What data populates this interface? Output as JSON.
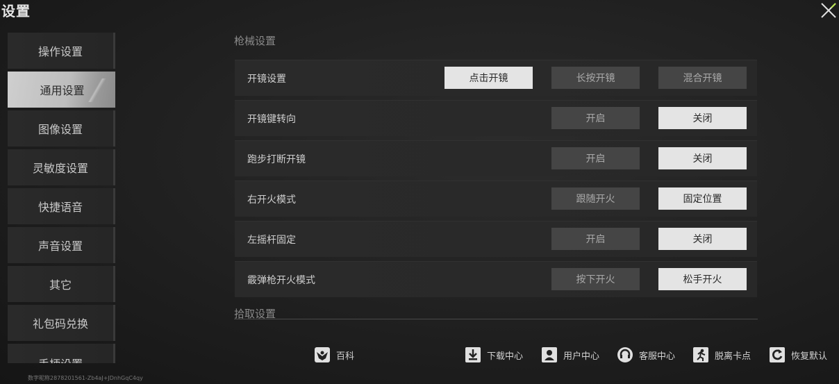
{
  "window": {
    "title": "设置"
  },
  "sidebar": {
    "items": [
      {
        "label": "操作设置"
      },
      {
        "label": "通用设置"
      },
      {
        "label": "图像设置"
      },
      {
        "label": "灵敏度设置"
      },
      {
        "label": "快捷语音"
      },
      {
        "label": "声音设置"
      },
      {
        "label": "其它"
      },
      {
        "label": "礼包码兑换"
      },
      {
        "label": "手柄设置"
      }
    ],
    "active_index": 1
  },
  "account_text": "数字昵称2878201561-Zb4aJ+JDnhGqC4qy",
  "gun_settings": {
    "title": "枪械设置",
    "rows": [
      {
        "label": "开镜设置",
        "options": [
          "点击开镜",
          "长按开镜",
          "混合开镜"
        ],
        "selected": "点击开镜"
      },
      {
        "label": "开镜键转向",
        "options": [
          "开启",
          "关闭"
        ],
        "selected": "关闭"
      },
      {
        "label": "跑步打断开镜",
        "options": [
          "开启",
          "关闭"
        ],
        "selected": "关闭"
      },
      {
        "label": "右开火模式",
        "options": [
          "跟随开火",
          "固定位置"
        ],
        "selected": "固定位置"
      },
      {
        "label": "左摇杆固定",
        "options": [
          "开启",
          "关闭"
        ],
        "selected": "关闭"
      },
      {
        "label": "霰弹枪开火模式",
        "options": [
          "按下开火",
          "松手开火"
        ],
        "selected": "松手开火"
      }
    ]
  },
  "pickup_settings": {
    "title": "拾取设置"
  },
  "bottom_bar": {
    "wiki": "百科",
    "download": "下载中心",
    "user": "用户中心",
    "service": "客服中心",
    "unstuck": "脱离卡点",
    "reset": "恢复默认"
  },
  "colors": {
    "selected_bg": "#e4e4e4",
    "option_bg": "#454545",
    "close_accent": "#b6e24a"
  }
}
